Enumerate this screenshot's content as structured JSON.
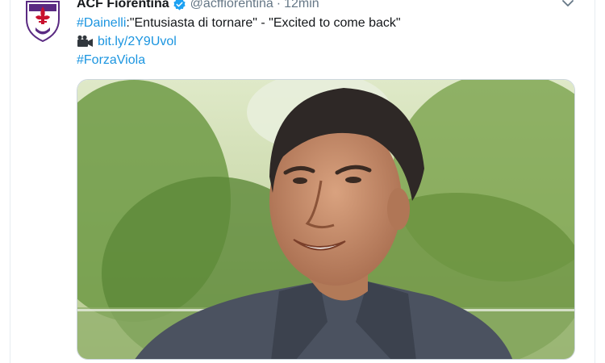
{
  "tweet": {
    "author_name": "ACF Fiorentina",
    "handle": "@acffiorentina",
    "separator": "·",
    "time": "12min",
    "hashtag1": "#Dainelli",
    "text_after_hashtag": ":\"Entusiasta di tornare\" - \"Excited to come back\"",
    "link": "bit.ly/2Y9Uvol",
    "hashtag2": "#ForzaViola"
  },
  "icons": {
    "avatar": "fiorentina-crest-icon",
    "verified": "verified-badge-icon",
    "menu": "chevron-down-icon",
    "camera": "movie-camera-icon"
  },
  "colors": {
    "link": "#1b95e0",
    "verified": "#1da1f2",
    "club_purple": "#5a2a82",
    "text": "#14171a",
    "muted": "#657786"
  }
}
